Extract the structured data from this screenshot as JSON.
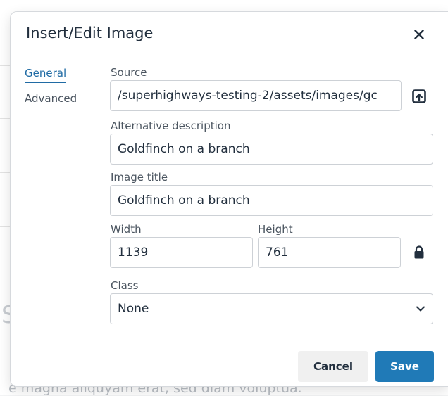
{
  "background": {
    "bottom_text": "e magna aliquyam erat, sed diam voluptua."
  },
  "dialog": {
    "title": "Insert/Edit Image",
    "tabs": [
      {
        "label": "General",
        "active": true
      },
      {
        "label": "Advanced",
        "active": false
      }
    ],
    "source": {
      "label": "Source",
      "value": "/superhighways-testing-2/assets/images/gc"
    },
    "alt": {
      "label": "Alternative description",
      "value": "Goldfinch on a branch"
    },
    "image_title": {
      "label": "Image title",
      "value": "Goldfinch on a branch"
    },
    "width": {
      "label": "Width",
      "value": "1139"
    },
    "height": {
      "label": "Height",
      "value": "761"
    },
    "class": {
      "label": "Class",
      "value": "None"
    },
    "buttons": {
      "cancel": "Cancel",
      "save": "Save"
    }
  },
  "colors": {
    "accent": "#207ab7",
    "tab_active": "#206ba4",
    "text": "#222f3e"
  },
  "icons": {
    "close": "close-icon",
    "browse": "upload-icon",
    "lock": "lock-icon",
    "dropdown": "chevron-down-icon"
  }
}
